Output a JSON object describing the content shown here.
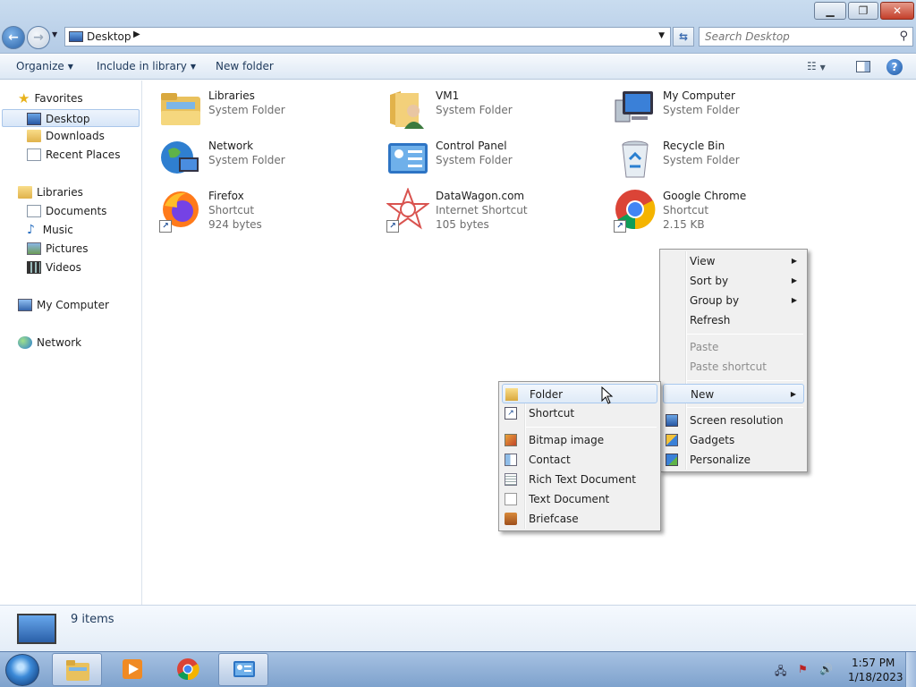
{
  "window": {
    "address": "Desktop",
    "search_placeholder": "Search Desktop"
  },
  "toolbar": {
    "organize": "Organize",
    "include_in_library": "Include in library",
    "new_folder": "New folder"
  },
  "sidebar": {
    "favorites": "Favorites",
    "desktop": "Desktop",
    "downloads": "Downloads",
    "recent_places": "Recent Places",
    "libraries": "Libraries",
    "documents": "Documents",
    "music": "Music",
    "pictures": "Pictures",
    "videos": "Videos",
    "my_computer": "My Computer",
    "network": "Network"
  },
  "items": [
    {
      "name": "Libraries",
      "line2": "System Folder",
      "line3": ""
    },
    {
      "name": "VM1",
      "line2": "System Folder",
      "line3": ""
    },
    {
      "name": "My Computer",
      "line2": "System Folder",
      "line3": ""
    },
    {
      "name": "Network",
      "line2": "System Folder",
      "line3": ""
    },
    {
      "name": "Control Panel",
      "line2": "System Folder",
      "line3": ""
    },
    {
      "name": "Recycle Bin",
      "line2": "System Folder",
      "line3": ""
    },
    {
      "name": "Firefox",
      "line2": "Shortcut",
      "line3": "924 bytes"
    },
    {
      "name": "DataWagon.com",
      "line2": "Internet Shortcut",
      "line3": "105 bytes"
    },
    {
      "name": "Google Chrome",
      "line2": "Shortcut",
      "line3": "2.15 KB"
    }
  ],
  "context_menu": {
    "view": "View",
    "sort_by": "Sort by",
    "group_by": "Group by",
    "refresh": "Refresh",
    "paste": "Paste",
    "paste_shortcut": "Paste shortcut",
    "new": "New",
    "screen_resolution": "Screen resolution",
    "gadgets": "Gadgets",
    "personalize": "Personalize"
  },
  "new_submenu": {
    "folder": "Folder",
    "shortcut": "Shortcut",
    "bitmap_image": "Bitmap image",
    "contact": "Contact",
    "rich_text_document": "Rich Text Document",
    "text_document": "Text Document",
    "briefcase": "Briefcase"
  },
  "details": {
    "item_count": "9 items"
  },
  "taskbar": {
    "time": "1:57 PM",
    "date": "1/18/2023"
  }
}
